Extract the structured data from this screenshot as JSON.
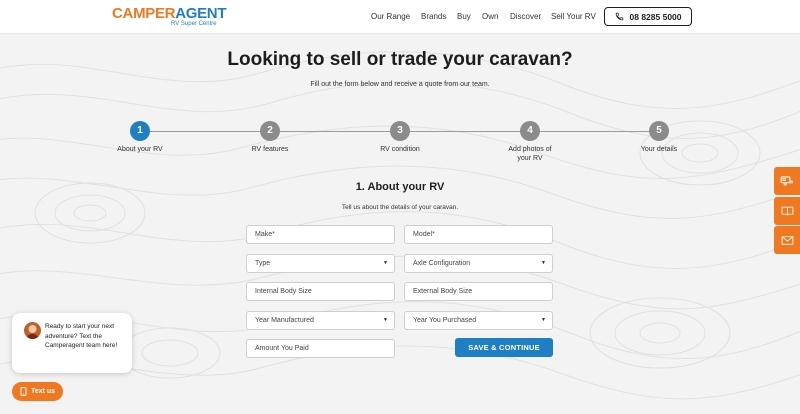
{
  "header": {
    "logo_main_1": "CAMPER",
    "logo_main_2": "AGENT",
    "logo_sub": "RV Super Centre",
    "nav": [
      "Our Range",
      "Brands",
      "Buy",
      "Own",
      "Discover",
      "Sell Your RV"
    ],
    "phone": "08 8285 5000"
  },
  "hero": {
    "title": "Looking to sell or trade your caravan?",
    "subtitle": "Fill out the form below and receive a quote from our team."
  },
  "steps": [
    {
      "num": "1",
      "label": "About your RV",
      "active": true
    },
    {
      "num": "2",
      "label": "RV features",
      "active": false
    },
    {
      "num": "3",
      "label": "RV condition",
      "active": false
    },
    {
      "num": "4",
      "label": "Add photos of your RV",
      "active": false
    },
    {
      "num": "5",
      "label": "Your details",
      "active": false
    }
  ],
  "form": {
    "section_title": "1. About your RV",
    "section_subtitle": "Tell us about the details of your caravan.",
    "fields": {
      "make": "Make*",
      "model": "Model*",
      "type": "Type",
      "axle": "Axle Configuration",
      "internal": "Internal Body Size",
      "external": "External Body Size",
      "year_manufactured": "Year Manufactured",
      "year_purchased": "Year You Purchased",
      "amount_paid": "Amount You Paid"
    },
    "save_label": "SAVE & CONTINUE"
  },
  "chat": {
    "message": "Ready to start your next adventure? Text the Camperagent team here!",
    "button": "Text us"
  },
  "colors": {
    "brand_orange": "#f07821",
    "brand_blue": "#1e7fc5",
    "step_inactive": "#8b8b8b"
  },
  "icons": {
    "phone": "phone-icon",
    "side_tabs": [
      "caravan-icon",
      "book-icon",
      "mail-icon"
    ],
    "chat_button": "phone-icon"
  }
}
